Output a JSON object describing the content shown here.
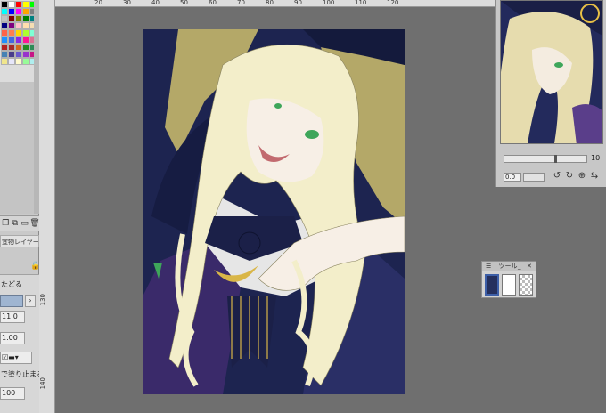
{
  "window": {
    "title": ""
  },
  "palette": {
    "colors": [
      "#000000",
      "#ffffff",
      "#ff0000",
      "#ffff00",
      "#00ff00",
      "#00ffff",
      "#0000ff",
      "#ff00ff",
      "#ffa500",
      "#808080",
      "#c0c0c0",
      "#800000",
      "#808000",
      "#008000",
      "#008080",
      "#000080",
      "#800080",
      "#ffc0cb",
      "#ffdead",
      "#f5deb3",
      "#ff6347",
      "#ff7f50",
      "#ffd700",
      "#adff2f",
      "#7fffd4",
      "#1e90ff",
      "#4169e1",
      "#8a2be2",
      "#ff1493",
      "#db7093",
      "#b22222",
      "#a52a2a",
      "#d2691e",
      "#228b22",
      "#2e8b57",
      "#4682b4",
      "#483d8b",
      "#6a5acd",
      "#9932cc",
      "#c71585",
      "#f0e68c",
      "#e6e6fa",
      "#fffacd",
      "#98fb98",
      "#afeeee"
    ]
  },
  "layer_panel": {
    "note": "宜物レイヤーを",
    "icons": [
      "new-layer-icon",
      "copy-icon",
      "folder-icon",
      "trash-icon"
    ]
  },
  "tool_properties": {
    "trace_label": "たどる",
    "size_value": "11.0",
    "opacity_value": "1.00",
    "fill_label": "で塗り止まる",
    "extra_value": "100"
  },
  "rulers": {
    "h_ticks": [
      "20",
      "30",
      "40",
      "50",
      "60",
      "70",
      "80",
      "90",
      "100",
      "110",
      "120"
    ],
    "v_ticks": [
      "130",
      "140"
    ]
  },
  "navigator": {
    "zoom_value": "10",
    "angle_value": "0.0"
  },
  "tool_palette": {
    "title": "ツール"
  },
  "colors": {
    "background": "#6f6f6f",
    "panel": "#c9c9c9",
    "canvas_navy": "#1d2450",
    "hair": "#f3eeca",
    "gold": "#b4a868"
  }
}
